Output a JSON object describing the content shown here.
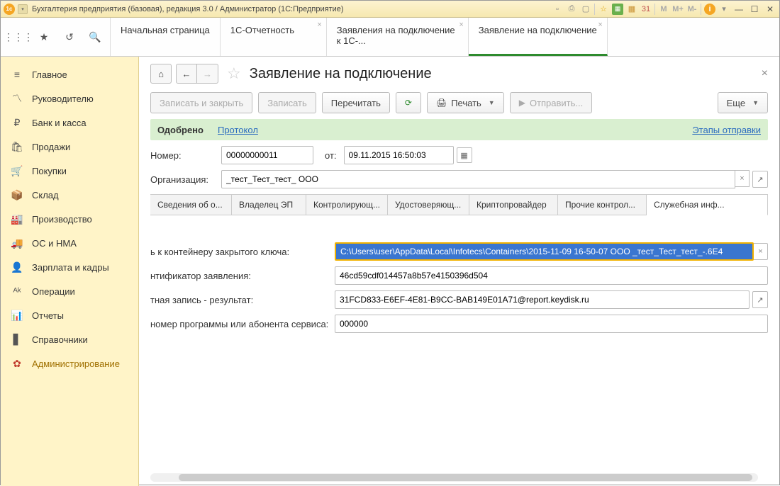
{
  "titlebar": {
    "title": "Бухгалтерия предприятия (базовая), редакция 3.0 / Администратор  (1С:Предприятие)",
    "calc_memory": [
      "M",
      "M+",
      "M-"
    ]
  },
  "main_tabs": [
    {
      "label": "Начальная страница",
      "closable": false
    },
    {
      "label": "1С-Отчетность",
      "closable": true
    },
    {
      "label": "Заявления на подключение к 1С-...",
      "closable": true
    },
    {
      "label": "Заявление на подключение",
      "closable": true,
      "active": true
    }
  ],
  "sidebar": [
    {
      "icon": "menu",
      "label": "Главное"
    },
    {
      "icon": "chart",
      "label": "Руководителю"
    },
    {
      "icon": "rub",
      "label": "Банк и касса"
    },
    {
      "icon": "cart",
      "label": "Продажи"
    },
    {
      "icon": "cart2",
      "label": "Покупки"
    },
    {
      "icon": "box",
      "label": "Склад"
    },
    {
      "icon": "factory",
      "label": "Производство"
    },
    {
      "icon": "truck",
      "label": "ОС и НМА"
    },
    {
      "icon": "person",
      "label": "Зарплата и кадры"
    },
    {
      "icon": "ops",
      "label": "Операции"
    },
    {
      "icon": "report",
      "label": "Отчеты"
    },
    {
      "icon": "book",
      "label": "Справочники"
    },
    {
      "icon": "gear",
      "label": "Администрирование"
    }
  ],
  "page": {
    "title": "Заявление на подключение"
  },
  "toolbar": {
    "save_close": "Записать и закрыть",
    "save": "Записать",
    "reread": "Перечитать",
    "print": "Печать",
    "send": "Отправить...",
    "more": "Еще"
  },
  "status": {
    "approved": "Одобрено",
    "protocol": "Протокол",
    "stages": "Этапы отправки"
  },
  "form": {
    "number_label": "Номер:",
    "number_value": "00000000011",
    "from_label": "от:",
    "date_value": "09.11.2015 16:50:03",
    "org_label": "Организация:",
    "org_value": "_тест_Тест_тест_ ООО"
  },
  "inner_tabs": [
    "Сведения об о...",
    "Владелец ЭП",
    "Контролирующ...",
    "Удостоверяющ...",
    "Криптопровайдер",
    "Прочие контрол...",
    "Служебная инф..."
  ],
  "service_info": {
    "key_container_label": "ь к контейнеру закрытого ключа:",
    "key_container_value": "C:\\Users\\user\\AppData\\Local\\Infotecs\\Containers\\2015-11-09 16-50-07 ООО _тест_Тест_тест_-.6E4",
    "app_id_label": "нтификатор заявления:",
    "app_id_value": "46cd59cdf014457a8b57e4150396d504",
    "account_label": "тная запись - результат:",
    "account_value": "31FCD833-E6EF-4E81-B9CC-BAB149E01A71@report.keydisk.ru",
    "prog_num_label": "номер программы или абонента сервиса:",
    "prog_num_value": "000000"
  }
}
